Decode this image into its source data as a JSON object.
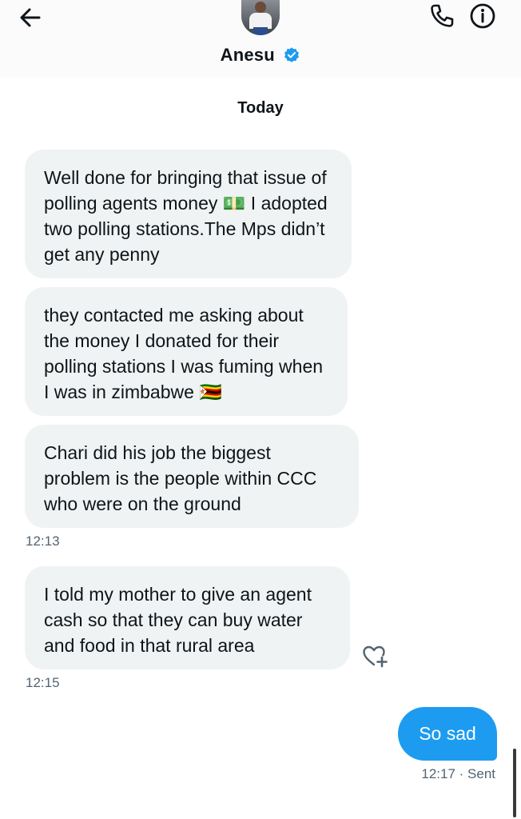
{
  "header": {
    "contact_name": "Anesu",
    "back_icon": "arrow-left-icon",
    "verified_icon": "verified-badge-icon",
    "call_icon": "phone-icon",
    "info_icon": "info-icon",
    "accent": "#1d9bf0"
  },
  "conversation": {
    "day_label": "Today",
    "received": [
      {
        "text": "Well done for bringing that issue of polling agents money 💵 I adopted two polling stations.The Mps didn’t get any penny"
      },
      {
        "text": "they contacted me asking about the money I donated for their polling stations I was fuming when I was in zimbabwe 🇿🇼"
      },
      {
        "text": "Chari did his job the biggest problem is the people within CCC who were on the ground"
      },
      {
        "text": "I told my mother to give an agent cash so that they can buy water and food in that rural area"
      }
    ],
    "timestamps": [
      "12:13",
      "12:15"
    ],
    "reaction_icon": "heart-plus-icon",
    "sent": {
      "text": "So sad",
      "status": "12:17 · Sent"
    }
  },
  "colors": {
    "received_bubble": "#eff3f4",
    "sent_bubble": "#1d9bf0",
    "muted_text": "#536471"
  }
}
